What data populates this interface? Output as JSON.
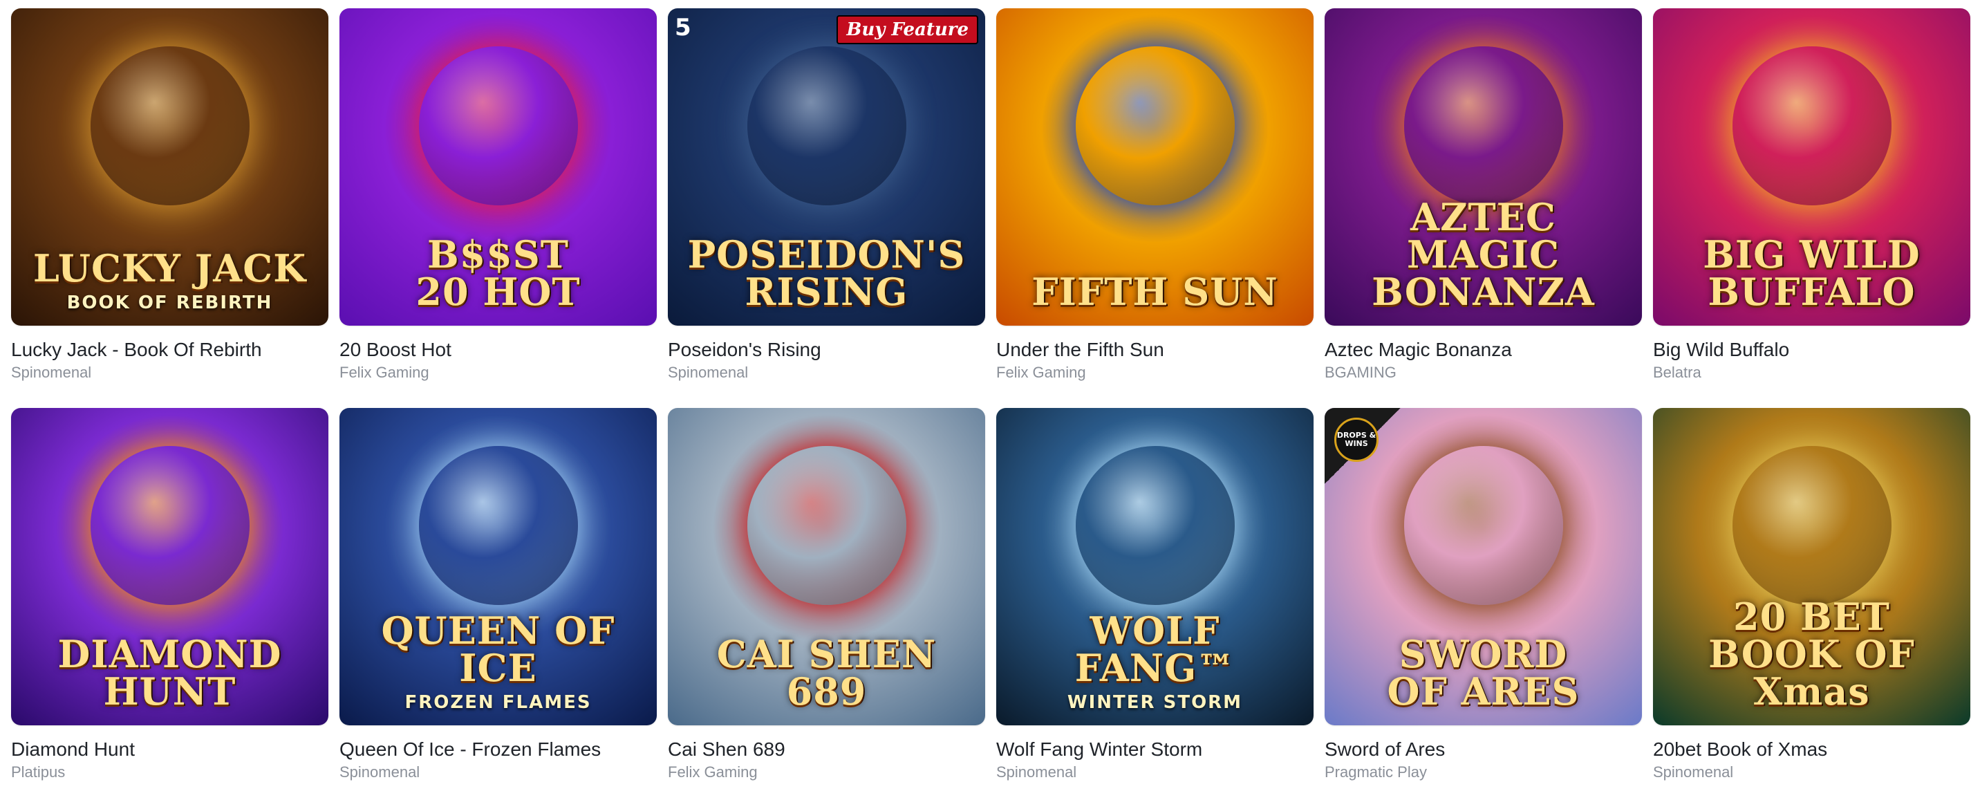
{
  "games": [
    {
      "name": "Lucky Jack - Book Of Rebirth",
      "provider": "Spinomenal",
      "art_title": "LUCKY JACK",
      "art_sub": "BOOK OF REBIRTH",
      "colors": [
        "#2a1406",
        "#6b3a12",
        "#c98b2a"
      ]
    },
    {
      "name": "20 Boost Hot",
      "provider": "Felix Gaming",
      "art_title": "B$$ST\n20 HOT",
      "art_sub": "",
      "colors": [
        "#5a0fb0",
        "#8a1fd6",
        "#e02050"
      ]
    },
    {
      "name": "Poseidon's Rising",
      "provider": "Spinomenal",
      "art_title": "POSEIDON'S\nRISING",
      "art_sub": "",
      "badge": "Buy Feature",
      "corner": "5",
      "colors": [
        "#0a1a3a",
        "#1c3566",
        "#3a5a8a"
      ]
    },
    {
      "name": "Under the Fifth Sun",
      "provider": "Felix Gaming",
      "art_title": "FIFTH SUN",
      "art_sub": "",
      "colors": [
        "#c84a00",
        "#f0a000",
        "#1a4ac8"
      ]
    },
    {
      "name": "Aztec Magic Bonanza",
      "provider": "BGAMING",
      "art_title": "AZTEC MAGIC\nBONANZA",
      "art_sub": "",
      "colors": [
        "#3a0a5a",
        "#7a1a8a",
        "#e0702a"
      ]
    },
    {
      "name": "Big Wild Buffalo",
      "provider": "Belatra",
      "art_title": "BIG WILD\nBUFFALO",
      "art_sub": "",
      "colors": [
        "#7a0a6a",
        "#d0205a",
        "#f0a02a"
      ]
    },
    {
      "name": "Diamond Hunt",
      "provider": "Platipus",
      "art_title": "DIAMOND HUNT",
      "art_sub": "",
      "colors": [
        "#2a0a6a",
        "#7a2ad0",
        "#f08a1a"
      ]
    },
    {
      "name": "Queen Of Ice - Frozen Flames",
      "provider": "Spinomenal",
      "art_title": "QUEEN OF ICE",
      "art_sub": "FROZEN FLAMES",
      "colors": [
        "#0a1a4a",
        "#2a4a9a",
        "#9ac8f0"
      ]
    },
    {
      "name": "Cai Shen 689",
      "provider": "Felix Gaming",
      "art_title": "CAI SHEN 689",
      "art_sub": "",
      "colors": [
        "#4a6a8a",
        "#a0b0c0",
        "#c81a1a"
      ]
    },
    {
      "name": "Wolf Fang Winter Storm",
      "provider": "Spinomenal",
      "art_title": "WOLF FANG™",
      "art_sub": "WINTER STORM",
      "colors": [
        "#0a1a2a",
        "#2a5a8a",
        "#a0d0f0"
      ]
    },
    {
      "name": "Sword of Ares",
      "provider": "Pragmatic Play",
      "art_title": "SWORD\nOF ARES",
      "art_sub": "",
      "drops": "DROPS & WINS",
      "colors": [
        "#6a7ac8",
        "#e0a0c0",
        "#8a4a1a"
      ]
    },
    {
      "name": "20bet Book of Xmas",
      "provider": "Spinomenal",
      "art_title": "20 BET\nBOOK OF Xmas",
      "art_sub": "",
      "colors": [
        "#0a3a2a",
        "#b07a1a",
        "#e0c050"
      ]
    }
  ]
}
